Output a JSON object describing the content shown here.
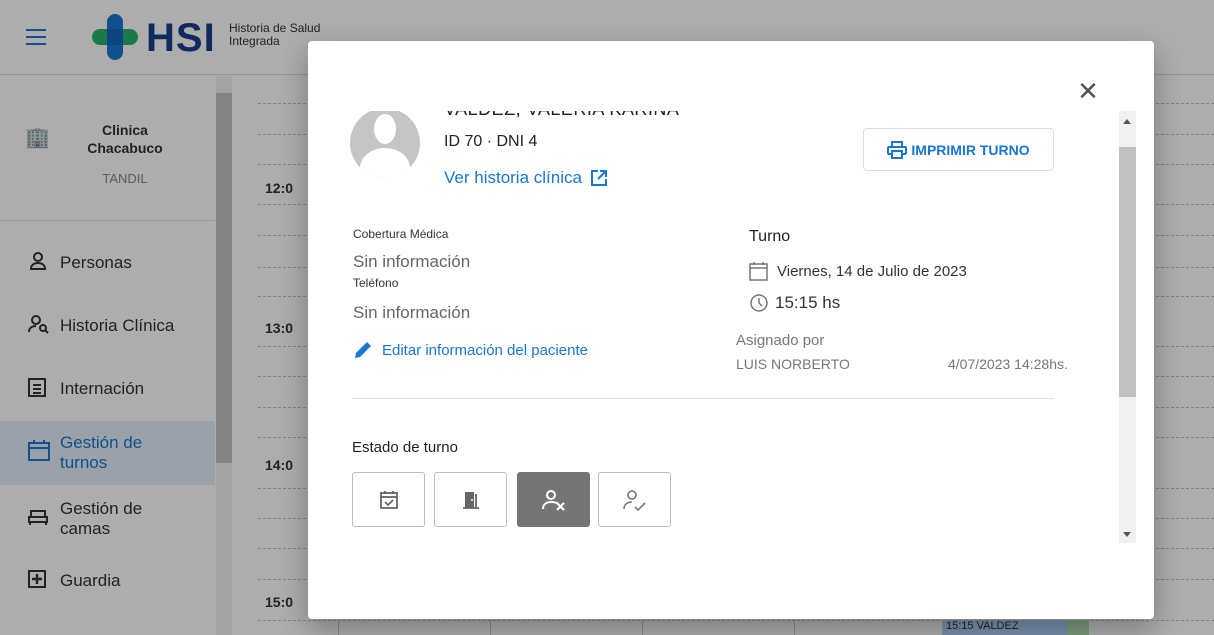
{
  "header": {
    "logo_text": "HSI",
    "logo_sub_line1": "Historia de Salud",
    "logo_sub_line2": "Integrada"
  },
  "sidebar": {
    "institution_line1": "Clinica",
    "institution_line2": "Chacabuco",
    "city": "TANDIL",
    "items": [
      {
        "label": "Personas"
      },
      {
        "label": "Historia Clínica"
      },
      {
        "label": "Internación"
      },
      {
        "label": "Gestión de turnos"
      },
      {
        "label": "Gestión de camas"
      },
      {
        "label": "Guardia"
      }
    ]
  },
  "calendar": {
    "times": [
      "12:0",
      "13:0",
      "14:0",
      "15:0"
    ],
    "chip": "15:15 VALDEZ"
  },
  "dialog": {
    "patient_name": "VALDEZ, VALERIA KARINA",
    "patient_id": "ID 70 · DNI 4",
    "ver_historia": "Ver historia clínica",
    "print_label": "IMPRIMIR TURNO",
    "cobertura_label": "Cobertura Médica",
    "cobertura_value": "Sin información",
    "telefono_label": "Teléfono",
    "telefono_value": "Sin información",
    "edit_label": "Editar información del paciente",
    "turno_title": "Turno",
    "turno_date": "Viernes, 14 de Julio de 2023",
    "turno_time": "15:15 hs",
    "asignado_label": "Asignado por",
    "asignado_name": "LUIS NORBERTO",
    "asignado_date": "4/07/2023 14:28hs.",
    "estado_label": "Estado de turno"
  },
  "colors": {
    "primary": "#1976d2",
    "selected_state": "#757575"
  }
}
